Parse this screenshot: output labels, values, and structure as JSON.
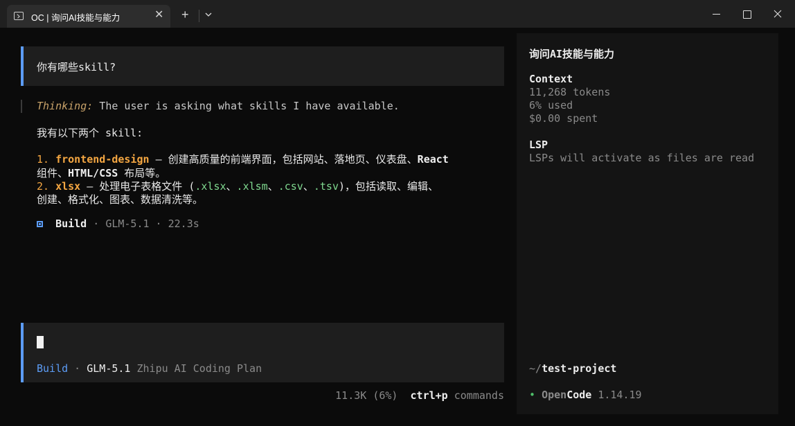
{
  "window": {
    "tab_title": "OC | 询问AI技能与能力",
    "tab_close": "✕",
    "new_tab": "+",
    "icons": [
      "terminal-icon",
      "close-icon",
      "plus-icon",
      "chevron-down-icon",
      "minimize-icon",
      "maximize-icon",
      "close-window-icon"
    ]
  },
  "conversation": {
    "user_message": "你有哪些skill?",
    "thinking_label": "Thinking:",
    "thinking_text": " The user is asking what skills I have available.",
    "intro": "我有以下两个 skill:",
    "item1": {
      "num": "1.",
      "name": "frontend-design",
      "desc_a": " — 创建高质量的前端界面，包括网站、落地页、仪表盘、",
      "react": "React",
      "desc_b_1": "组件、",
      "html_css": "HTML/CSS",
      "desc_b_2": " 布局等。"
    },
    "item2": {
      "num": "2.",
      "name": "xlsx",
      "desc_a": " — 处理电子表格文件 (",
      "ext1": ".xlsx",
      "sep1": "、",
      "ext2": ".xlsm",
      "sep2": "、",
      "ext3": ".csv",
      "sep3": "、",
      "ext4": ".tsv",
      "desc_b": ")，包括读取、编辑、",
      "desc_c": "创建、格式化、图表、数据清洗等。"
    },
    "footer": {
      "agent": "Build",
      "sep": " · ",
      "model": "GLM-5.1",
      "sep2": " · ",
      "duration": "22.3s"
    }
  },
  "input": {
    "agent": "Build",
    "sep": " · ",
    "model": "GLM-5.1",
    "provider": " Zhipu AI Coding Plan"
  },
  "status": {
    "tokens": "11.3K (6%)",
    "shortcut": "ctrl+p",
    "shortcut_label": " commands"
  },
  "sidebar": {
    "title": "询问AI技能与能力",
    "context_heading": "Context",
    "tokens": "11,268 tokens",
    "used": "6% used",
    "spent": "$0.00 spent",
    "lsp_heading": "LSP",
    "lsp_text": "LSPs will activate as files are read",
    "path_prefix": "~/",
    "path_name": "test-project",
    "bullet": "•",
    "app_open": "Open",
    "app_code": "Code",
    "version": " 1.14.19"
  },
  "colors": {
    "accent": "#5c9cf5",
    "orange": "#f5a742",
    "green": "#7fd88f",
    "muted": "#8a8a8a"
  }
}
